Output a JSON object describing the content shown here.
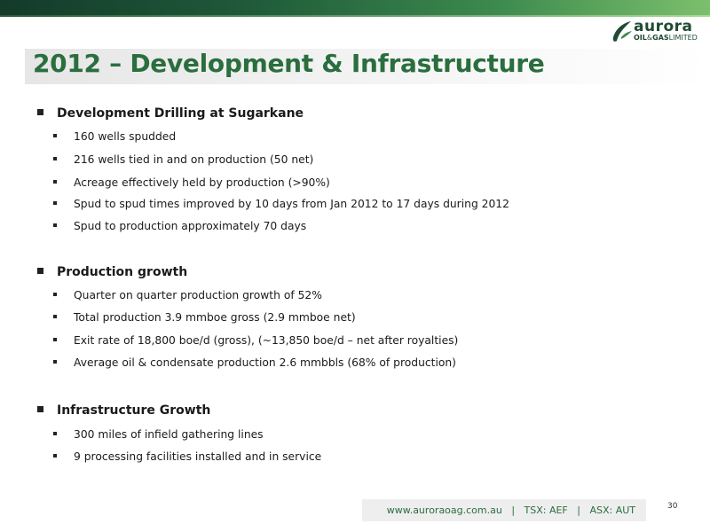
{
  "header": {
    "logo": {
      "name": "aurora",
      "sub_bold_1": "OIL",
      "sub_amp": "&",
      "sub_bold_2": "GAS",
      "sub_rest": "LIMITED"
    }
  },
  "slide": {
    "title": "2012 – Development & Infrastructure",
    "sections": [
      {
        "heading": "Development Drilling at Sugarkane",
        "items": [
          "160 wells spudded",
          "216 wells tied in and on production (50 net)",
          "Acreage effectively held by production (>90%)",
          "Spud to spud times improved by 10 days from Jan 2012 to 17 days during 2012",
          "Spud to production approximately 70 days"
        ]
      },
      {
        "heading": "Production growth",
        "items": [
          "Quarter on quarter production growth of 52%",
          "Total production 3.9 mmboe gross (2.9 mmboe net)",
          "Exit rate of 18,800 boe/d (gross), (~13,850 boe/d – net after royalties)",
          "Average oil & condensate production 2.6 mmbbls (68% of production)"
        ]
      },
      {
        "heading": "Infrastructure Growth",
        "items": [
          "300 miles of infield gathering lines",
          "9 processing facilities installed and in service"
        ]
      }
    ]
  },
  "footer": {
    "links": "www.auroraoag.com.au   |   TSX: AEF   |   ASX: AUT",
    "page_number": "30"
  },
  "colors": {
    "brand_green": "#2a6e3e",
    "band_dark": "#143a2a",
    "band_light": "#7cc06c"
  }
}
